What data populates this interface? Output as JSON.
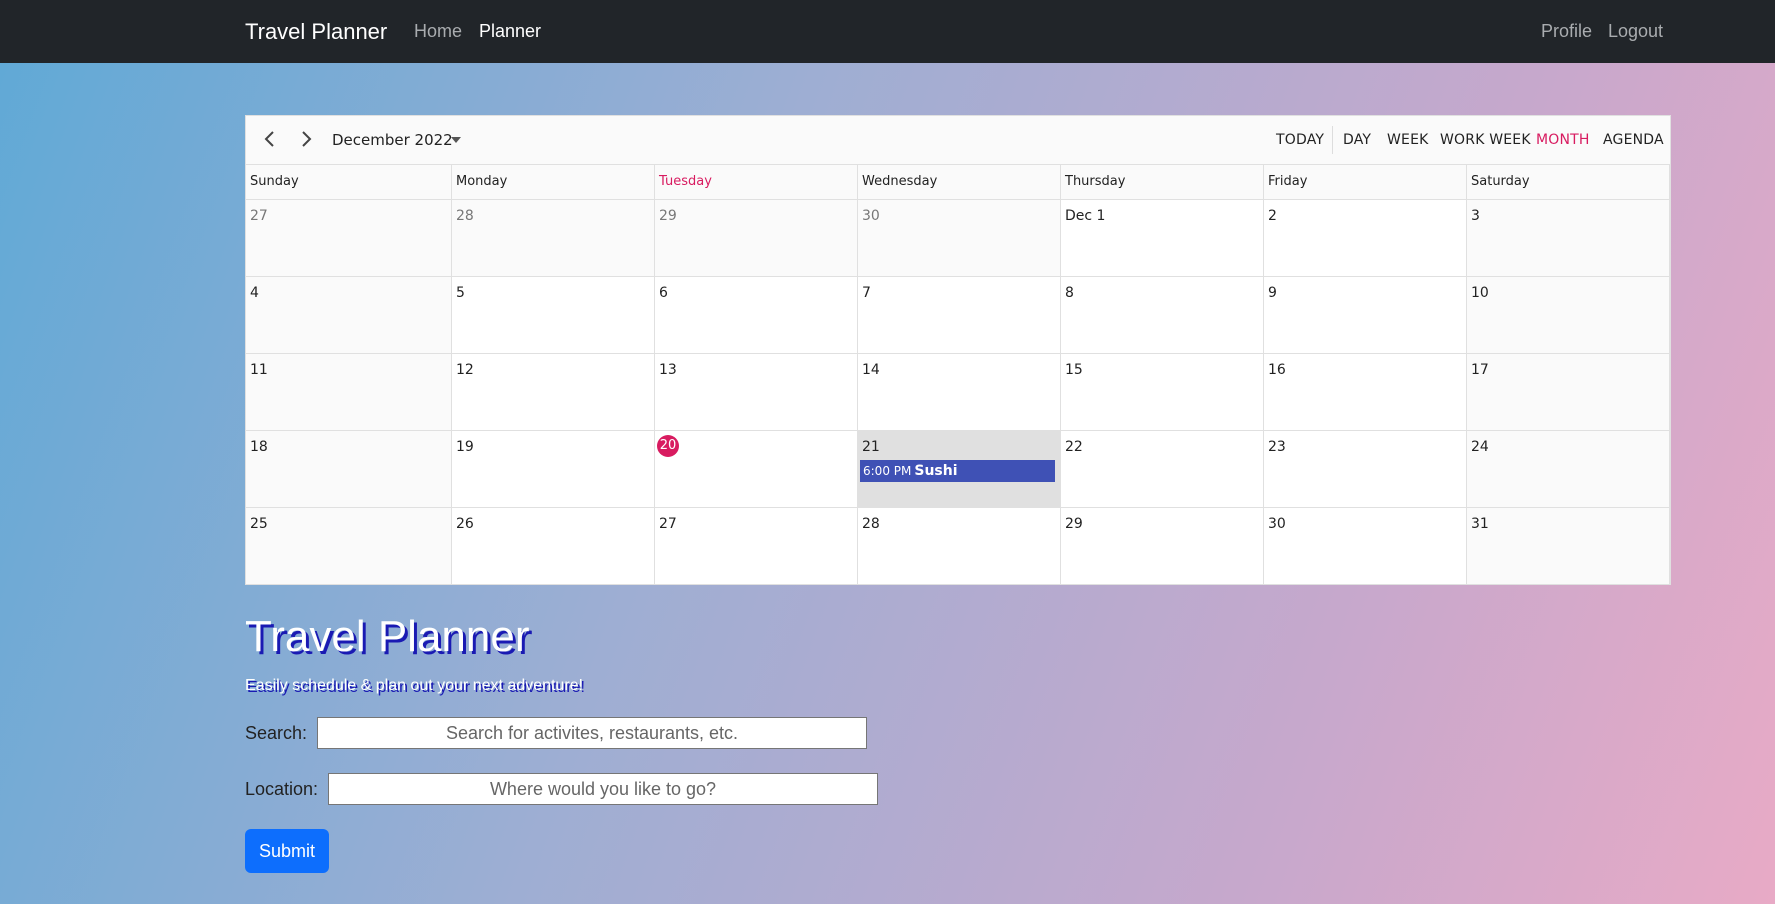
{
  "nav": {
    "brand": "Travel Planner",
    "links": [
      {
        "label": "Home",
        "active": false
      },
      {
        "label": "Planner",
        "active": true
      }
    ],
    "right_links": [
      {
        "label": "Profile"
      },
      {
        "label": "Logout"
      }
    ]
  },
  "calendar": {
    "month_label": "December 2022",
    "views": [
      "TODAY",
      "DAY",
      "WEEK",
      "WORK WEEK",
      "MONTH",
      "AGENDA"
    ],
    "active_view": "MONTH",
    "weekdays": [
      "Sunday",
      "Monday",
      "Tuesday",
      "Wednesday",
      "Thursday",
      "Friday",
      "Saturday"
    ],
    "today_weekday_index": 2,
    "weeks": [
      [
        "27",
        "28",
        "29",
        "30",
        "Dec 1",
        "2",
        "3"
      ],
      [
        "4",
        "5",
        "6",
        "7",
        "8",
        "9",
        "10"
      ],
      [
        "11",
        "12",
        "13",
        "14",
        "15",
        "16",
        "17"
      ],
      [
        "18",
        "19",
        "20",
        "21",
        "22",
        "23",
        "24"
      ],
      [
        "25",
        "26",
        "27",
        "28",
        "29",
        "30",
        "31"
      ]
    ],
    "other_month_cells": [
      [
        0,
        0
      ],
      [
        0,
        1
      ],
      [
        0,
        2
      ],
      [
        0,
        3
      ]
    ],
    "today_cell": [
      3,
      2
    ],
    "selected_cell": [
      3,
      3
    ],
    "events": [
      {
        "week": 3,
        "day": 3,
        "time": "6:00 PM",
        "title": "Sushi",
        "color": "#3f51b5"
      }
    ],
    "accent_color": "#d81b60"
  },
  "hero": {
    "title": "Travel Planner",
    "subtitle": "Easily schedule & plan out your next adventure!"
  },
  "form": {
    "search_label": "Search:",
    "search_placeholder": "Search for activites, restaurants, etc.",
    "location_label": "Location:",
    "location_placeholder": "Where would you like to go?",
    "submit_label": "Submit"
  }
}
